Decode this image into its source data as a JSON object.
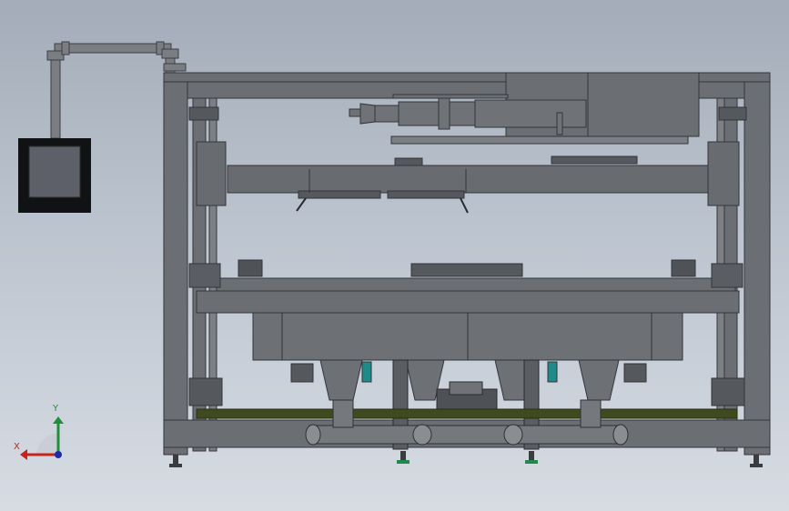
{
  "viewport": {
    "background_top": "#a3acb8",
    "background_bottom": "#d7dce3"
  },
  "model": {
    "body_color": "#6b6e73",
    "dark_color": "#4a4c50",
    "accent_color": "#1f8a8a",
    "floor_color": "#3f4a1f",
    "hmi_screen_color": "#5d6068",
    "parts": [
      "main-frame",
      "top-conveyor",
      "pneumatic-cylinder",
      "upper-carriage",
      "mid-platform",
      "hopper-tanks",
      "discharge-chutes",
      "bottom-pipe",
      "leveling-feet",
      "hmi-panel",
      "cable-conduit"
    ]
  },
  "triad": {
    "y_label": "Y",
    "x_label": "X",
    "y_color": "#1f8f3a",
    "x_color": "#c4241b",
    "z_color": "#1f2aa8"
  }
}
